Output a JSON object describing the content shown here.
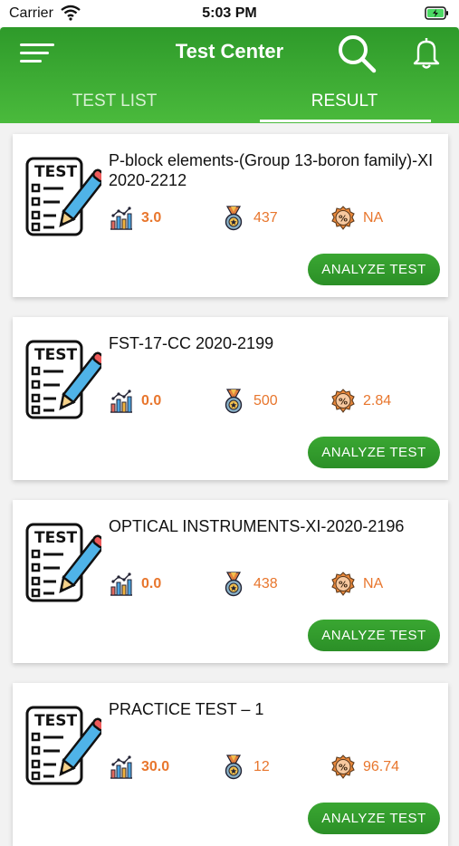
{
  "status_bar": {
    "carrier": "Carrier",
    "time": "5:03 PM"
  },
  "header": {
    "title": "Test Center"
  },
  "tabs": [
    {
      "label": "TEST LIST",
      "active": false
    },
    {
      "label": "RESULT",
      "active": true
    }
  ],
  "colors": {
    "accent_green": "#2e9a2a",
    "stat_orange": "#e8762d"
  },
  "tests": [
    {
      "title": "P-block elements-(Group 13-boron family)-XI 2020-2212",
      "rank": "3.0",
      "marks": "437",
      "percent": "NA",
      "button": "ANALYZE TEST"
    },
    {
      "title": "FST-17-CC 2020-2199",
      "rank": "0.0",
      "marks": "500",
      "percent": "2.84",
      "button": "ANALYZE TEST"
    },
    {
      "title": "OPTICAL INSTRUMENTS-XI-2020-2196",
      "rank": "0.0",
      "marks": "438",
      "percent": "NA",
      "button": "ANALYZE TEST"
    },
    {
      "title": "PRACTICE TEST – 1",
      "rank": "30.0",
      "marks": "12",
      "percent": "96.74",
      "button": "ANALYZE TEST"
    }
  ],
  "icons": [
    "menu-icon",
    "search-icon",
    "bell-icon",
    "test-sheet-icon",
    "bar-chart-icon",
    "medal-icon",
    "percent-badge-icon"
  ]
}
